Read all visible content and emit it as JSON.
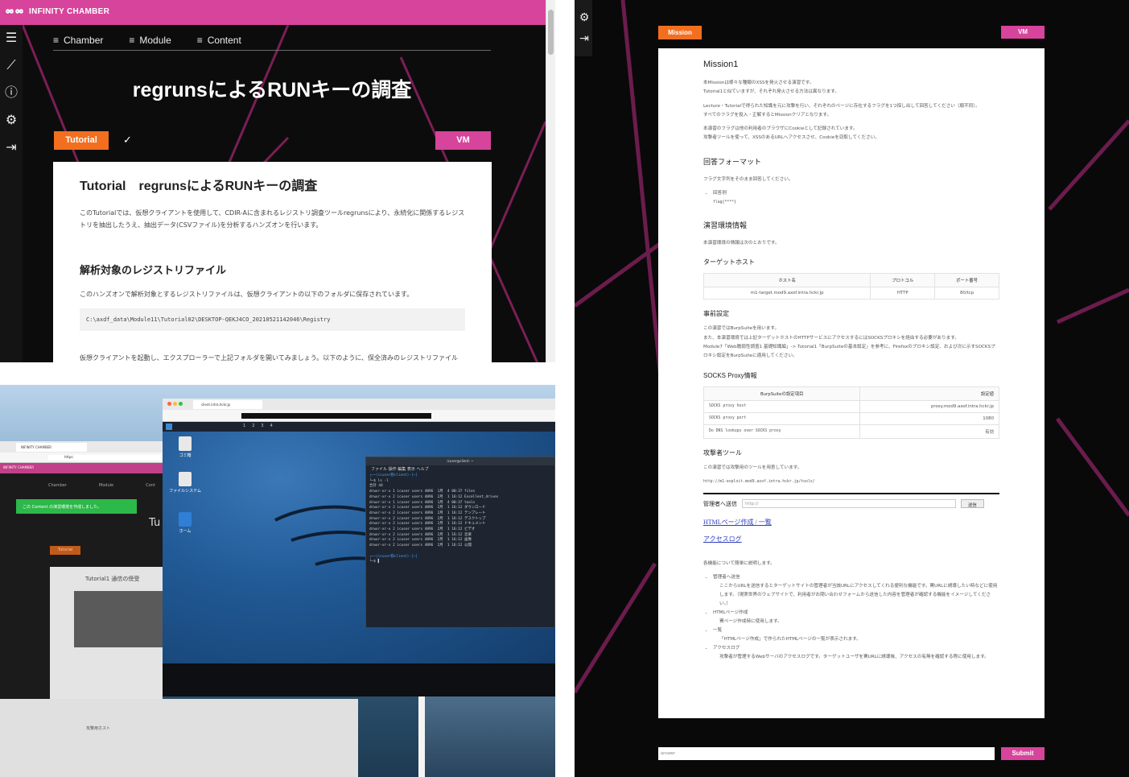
{
  "left_top": {
    "brand": "INFINITY CHAMBER",
    "nav": [
      "Chamber",
      "Module",
      "Content"
    ],
    "hero_title": "regrunsによるRUNキーの調査",
    "tutorial_label": "Tutorial",
    "vm_label": "VM",
    "card_title": "Tutorial　regrunsによるRUNキーの調査",
    "intro": "このTutorialでは、仮想クライアントを使用して、CDIR-Aに含まれるレジストリ調査ツールregrunsにより、永続化に関係するレジストリを抽出したうえ、抽出データ(CSVファイル)を分析するハンズオンを行います。",
    "section_title": "解析対象のレジストリファイル",
    "section_text": "このハンズオンで解析対象とするレジストリファイルは、仮想クライアントの以下のフォルダに保存されています。",
    "path": "C:\\axdf_data\\Module11\\Tutorial02\\DESKTOP-QEKJ4CO_20210521142046\\Registry",
    "tail_text": "仮想クライアントを起動し、エクスプローラーで上記フォルダを開いてみましょう。以下のように、保全済みのレジストリファイル"
  },
  "left_bottom": {
    "browser_tab": "INFINITY CHAMBER",
    "url_stub": "https:",
    "brand_small": "INFINITY CHAMBER",
    "toast": "この Content の演習環境を作成しました。",
    "back_nav": [
      "Chamber",
      "Module",
      "Cont"
    ],
    "back_title": "Tutorial1 通信の傍受",
    "back_tutorial": "Tutorial",
    "back_fragment": "Tu",
    "back_section": "攻撃用ホスト",
    "kali_tab": "client.intra.hckr.jp",
    "workspaces": [
      "1",
      "2",
      "3",
      "4"
    ],
    "desktop_icons": [
      "ゴミ箱",
      "ファイルシステム",
      "ホーム"
    ],
    "terminal_title": "icuser@client: ~",
    "terminal_menu": [
      "ファイル",
      "操作",
      "編集",
      "表示",
      "ヘルプ"
    ],
    "terminal_lines": [
      "┌──(icuser㉿client)-[~]",
      "└─$ ls -l",
      "合計 44",
      "drwxr-xr-x 1 icuser users 4096  1月  4 00:37 files",
      "drwxr-xr-x 2 icuser users 4096  2月  1 16:12 Excellent_drives",
      "drwxr-xr-x 1 icuser users 4096  1月  4 00:37 tools",
      "drwxr-xr-x 2 icuser users 4096  2月  1 16:12 ダウンロード",
      "drwxr-xr-x 2 icuser users 4096  2月  1 16:12 テンプレート",
      "drwxr-xr-x 2 icuser users 4096  2月  1 16:12 デスクトップ",
      "drwxr-xr-x 2 icuser users 4096  2月  1 16:12 ドキュメント",
      "drwxr-xr-x 2 icuser users 4096  2月  1 16:12 ビデオ",
      "drwxr-xr-x 2 icuser users 4096  2月  1 16:12 音楽",
      "drwxr-xr-x 2 icuser users 4096  2月  1 16:12 画像",
      "drwxr-xr-x 2 icuser users 4096  2月  1 16:12 公開",
      "",
      "┌──(icuser㉿client)-[~]",
      "└─$ ▌"
    ]
  },
  "right": {
    "mission_label": "Mission",
    "vm_label": "VM",
    "title": "Mission1",
    "intro": [
      "本Missionは様々な種類のXSSを発火させる演習です。",
      "Tutorial1と似ていますが、それぞれ発火させる方法は異なります。",
      "Lecture・Tutorialで得られた知識を元に攻撃を行い、それぞれのページに存在するフラグを1つ探し出して回答してください（順不同）。",
      "すべてのフラグを投入・正解するとMissionクリアとなります。",
      "本演習のフラグは他の利用者のブラウザにCookieとして記録されています。",
      "攻撃者ツールを使って、XSSのあるURLへアクセスさせ、Cookieを窃取してください。"
    ],
    "answer_format_title": "回答フォーマット",
    "answer_format_text": "フラグ文字列をそのまま回答してください。",
    "answer_example_label": "回答例",
    "answer_example": "flag{****}",
    "env_title": "演習環境情報",
    "env_text": "本演習環境の情報は次のとおりです。",
    "target_title": "ターゲットホスト",
    "target_headers": [
      "ホスト名",
      "プロトコル",
      "ポート番号"
    ],
    "target_row": [
      "m1-target.mod9.axof.intra.hckr.jp",
      "HTTP",
      "80/tcp"
    ],
    "pre_title": "事前設定",
    "pre_text": [
      "この演習ではBurpSuiteを用います。",
      "また、本演習環境では上記ターゲットホストのHTTPサービスにアクセスするにはSOCKSプロキシを経由する必要があります。",
      "Module7「Web脆弱性調査1 基礎知識編」-> Tutorial1「BurpSuiteの基本設定」を参考に、Firefoxのプロキシ設定、および次に示すSOCKSプロキシ設定をBurpSuiteに適用してください。"
    ],
    "socks_title": "SOCKS Proxy情報",
    "socks_headers": [
      "BurpSuiteの設定項目",
      "設定値"
    ],
    "socks_rows": [
      [
        "SOCKS proxy host",
        "proxy.mod9.axof.intra.hckr.jp"
      ],
      [
        "SOCKS proxy port",
        "1080"
      ],
      [
        "Do DNS lookups over SOCKS proxy",
        "有効"
      ]
    ],
    "attacker_title": "攻撃者ツール",
    "attacker_text": "この演習では攻撃用のツールを用意しています。",
    "attacker_url": "http://m1-exploit.mod9.axof.intra.hckr.jp/tools/",
    "send_label": "管理者へ送信",
    "send_placeholder": "http://",
    "send_button": "送信",
    "link_html": "HTMLページ作成",
    "link_sep": " / ",
    "link_list": "一覧",
    "link_log": "アクセスログ",
    "func_intro": "各機能について簡単に説明します。",
    "func_items": [
      {
        "name": "管理者へ送信",
        "desc": "ここからURLを送信するとターゲットサイトの管理者が当該URLにアクセスしてくれる便利な機能です。罠URLに誘導したい時などに使用します。（現実世界のウェブサイトで、利用者がお問い合わせフォームから送信した内容を管理者が確認する機能をイメージしてください。）"
      },
      {
        "name": "HTMLページ作成",
        "desc": "罠ページ作成時に使用します。"
      },
      {
        "name": "一覧",
        "desc": "「HTMLページ作成」で作られたHTMLページの一覧が表示されます。"
      },
      {
        "name": "アクセスログ",
        "desc": "攻撃者が管理するWebサーバのアクセスログです。ターゲットユーザを罠URLに誘導後、アクセスの有無を確認する際に使用します。"
      }
    ],
    "answer_placeholder": "answer",
    "submit_label": "Submit"
  },
  "colors": {
    "magenta": "#d7449b",
    "orange": "#f26f1f",
    "link": "#2c3fbf"
  }
}
